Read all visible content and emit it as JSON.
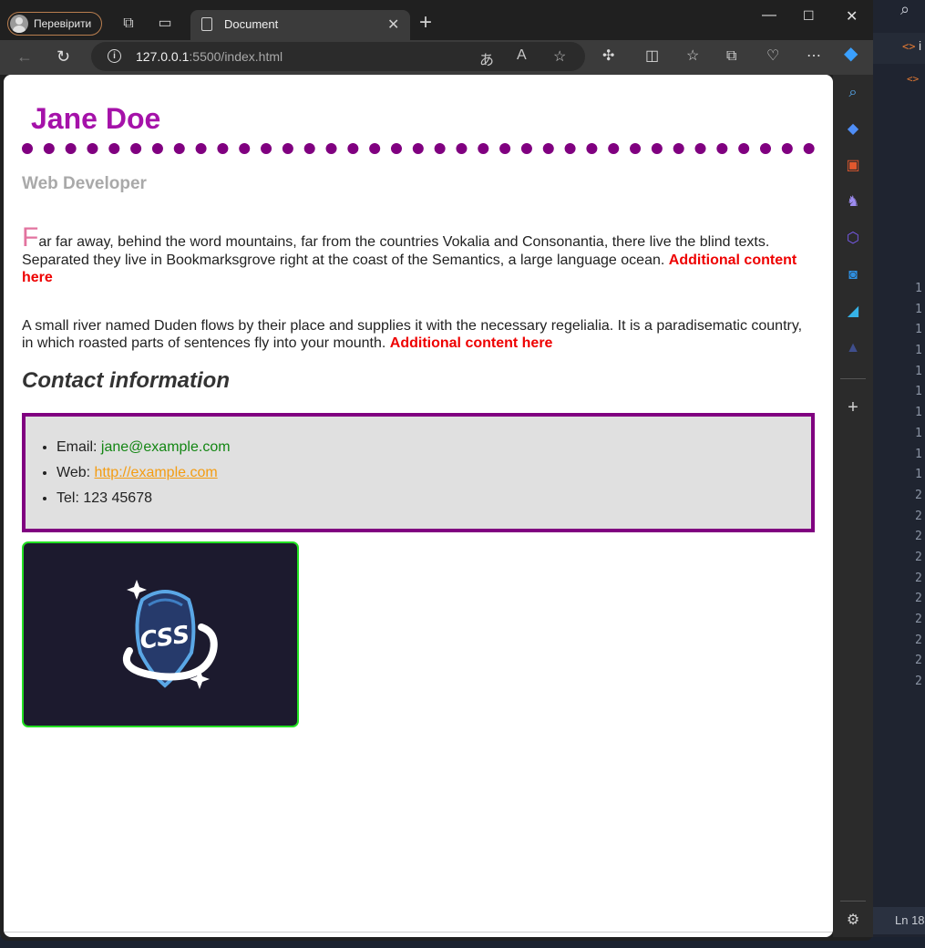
{
  "browser": {
    "profile_label": "Перевірити",
    "tab_title": "Document",
    "url_host": "127.0.0.1",
    "url_rest": ":5500/index.html"
  },
  "page": {
    "name": "Jane Doe",
    "role": "Web Developer",
    "p1_dropcap": "F",
    "p1_text": "ar far away, behind the word mountains, far from the countries Vokalia and Consonantia, there live the blind texts. Separated they live in Bookmarksgrove right at the coast of the Semantics, a large language ocean.",
    "p1_extra": "Additional content here",
    "p2_text": "A small river named Duden flows by their place and supplies it with the necessary regelialia. It is a paradisematic country, in which roasted parts of sentences fly into your mounth.",
    "p2_extra": "Additional content here",
    "contact_heading": "Contact information",
    "contact": {
      "email_label": "Email:",
      "email_value": "jane@example.com",
      "web_label": "Web:",
      "web_value": "http://example.com",
      "tel_label": "Tel:",
      "tel_value": "123 45678"
    },
    "logo_text": "CSS"
  },
  "editor": {
    "tab_text": "i",
    "status_text": "Ln 18",
    "line_numbers": [
      "1",
      "1",
      "1",
      "1",
      "1",
      "1",
      "1",
      "1",
      "1",
      "1",
      "2",
      "2",
      "2",
      "2",
      "2",
      "2",
      "2",
      "2",
      "2",
      "2"
    ]
  },
  "colors": {
    "name": "#a512a9",
    "dots": "#800080",
    "role": "#a9a9a9",
    "dropcap": "#e2739f",
    "additional": "#ee0000",
    "email": "#138613",
    "web": "#f39c12",
    "contact_border": "#800080",
    "contact_bg": "#e0e0e0",
    "logo_border": "#22e022",
    "logo_bg": "#1c1a2e"
  }
}
